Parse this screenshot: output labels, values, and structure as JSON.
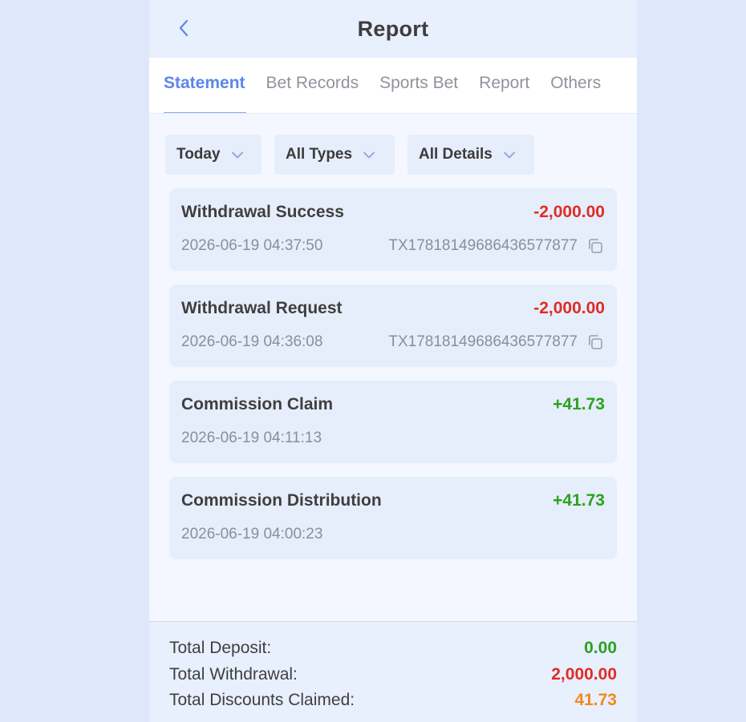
{
  "header": {
    "title": "Report"
  },
  "tabs": [
    {
      "label": "Statement",
      "active": true
    },
    {
      "label": "Bet Records",
      "active": false
    },
    {
      "label": "Sports Bet",
      "active": false
    },
    {
      "label": "Report",
      "active": false
    },
    {
      "label": "Others",
      "active": false
    }
  ],
  "filters": {
    "date": "Today",
    "types": "All Types",
    "details": "All Details"
  },
  "records": [
    {
      "title": "Withdrawal Success",
      "amount": "-2,000.00",
      "time": "2026-06-19 04:37:50",
      "tx": "TX1781814968643657787​7"
    },
    {
      "title": "Withdrawal Request",
      "amount": "-2,000.00",
      "time": "2026-06-19 04:36:08",
      "tx": "TX17818149686436577877"
    },
    {
      "title": "Commission Claim",
      "amount": "+41.73",
      "time": "2026-06-19 04:11:13",
      "tx": ""
    },
    {
      "title": "Commission Distribution",
      "amount": "+41.73",
      "time": "2026-06-19 04:00:23",
      "tx": ""
    }
  ],
  "summary": {
    "deposit_label": "Total Deposit:",
    "deposit_value": "0.00",
    "withdrawal_label": "Total Withdrawal:",
    "withdrawal_value": "2,000.00",
    "discounts_label": "Total Discounts Claimed:",
    "discounts_value": "41.73"
  },
  "colors": {
    "accent": "#5b87e6",
    "negative": "#de2d25",
    "positive": "#2aa21f",
    "discount": "#f08a1c"
  },
  "icons": {
    "back": "chevron-left-icon",
    "dropdown": "chevron-down-icon",
    "copy": "copy-icon"
  }
}
